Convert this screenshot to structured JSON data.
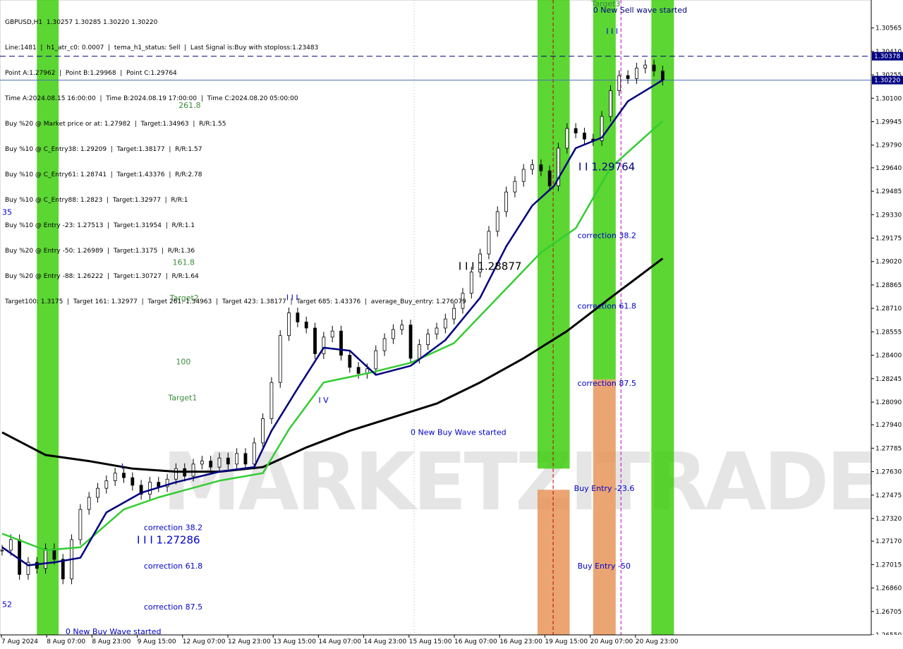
{
  "symbol_line": "GBPUSD,H1  1.30257 1.30285 1.30220 1.30220",
  "info_lines": [
    "Line:1481  |  h1_atr_c0: 0.0007  |  tema_h1_status: Sell  |  Last Signal is:Buy with stoploss:1.23483",
    "Point A:1.27962  |  Point B:1.29968  |  Point C:1.29764",
    "Time A:2024.08.15 16:00:00  |  Time B:2024.08.19 17:00:00  |  Time C:2024.08.20 05:00:00",
    "Buy %20 @ Market price or at: 1.27982  |  Target:1.34963  |  R/R:1.55",
    "Buy %10 @ C_Entry38: 1.29209  |  Target:1.38177  |  R/R:1.57",
    "Buy %10 @ C_Entry61: 1.28741  |  Target:1.43376  |  R/R:2.78",
    "Buy %10 @ C_Entry88: 1.2823  |  Target:1.32977  |  R/R:1",
    "Buy %10 @ Entry -23: 1.27513  |  Target:1.31954  |  R/R:1.1",
    "Buy %20 @ Entry -50: 1.26989  |  Target:1.3175  |  R/R:1.36",
    "Buy %20 @ Entry -88: 1.26222  |  Target:1.30727  |  R/R:1.64",
    "Target100: 1.3175  |  Target 161: 1.32977  |  Target 261: 1.34963  |  Target 423: 1.38177  |  Target 685: 1.43376  |  average_Buy_entry: 1.276079"
  ],
  "watermark": "MARKETZITRADE",
  "colors": {
    "green_band": "#33cc00",
    "orange_zone": "#e8955a",
    "blue_line": "#000080",
    "green_ma": "#32cd32",
    "black_ma": "#000000",
    "red_arrow": "#ff0000",
    "blue_arrow": "#0000ff",
    "current_price_line": "#000080",
    "price_tag_bg": "#000080"
  },
  "chart_data": {
    "type": "candlestick",
    "symbol": "GBPUSD",
    "timeframe": "H1",
    "ohlc_last": {
      "open": 1.30257,
      "high": 1.30285,
      "low": 1.3022,
      "close": 1.3022
    },
    "ylim": [
      1.2655,
      1.3075
    ],
    "y_ticks": [
      "1.30565",
      "1.30410",
      "1.30255",
      "1.30100",
      "1.29945",
      "1.29790",
      "1.29640",
      "1.29485",
      "1.29330",
      "1.29175",
      "1.29020",
      "1.28865",
      "1.28710",
      "1.28555",
      "1.28400",
      "1.28245",
      "1.28090",
      "1.27940",
      "1.27785",
      "1.27630",
      "1.27475",
      "1.27320",
      "1.27170",
      "1.27015",
      "1.26860",
      "1.26705",
      "1.26550"
    ],
    "x_ticks": [
      "7 Aug 2024",
      "8 Aug 07:00",
      "8 Aug 23:00",
      "9 Aug 15:00",
      "12 Aug 07:00",
      "12 Aug 23:00",
      "13 Aug 15:00",
      "14 Aug 07:00",
      "14 Aug 23:00",
      "15 Aug 15:00",
      "16 Aug 07:00",
      "16 Aug 23:00",
      "19 Aug 15:00",
      "20 Aug 07:00",
      "20 Aug 23:00"
    ],
    "price_tags": [
      {
        "label": "1.30378",
        "price": 1.30378
      },
      {
        "label": "1.30220",
        "price": 1.3022
      }
    ],
    "annotations": [
      {
        "text": "0 New Sell wave started",
        "t": 0.68,
        "price": 1.30665
      },
      {
        "text": "I I I",
        "t": 0.695,
        "price": 1.30525
      },
      {
        "text": "I I 1.29764",
        "t": 0.663,
        "price": 1.29623
      },
      {
        "text": "I I I 1.28877",
        "t": 0.525,
        "price": 1.28965
      },
      {
        "text": "I I I",
        "t": 0.327,
        "price": 1.28765
      },
      {
        "text": "I V",
        "t": 0.364,
        "price": 1.28085
      },
      {
        "text": "0 New Buy Wave started",
        "t": 0.47,
        "price": 1.27873
      },
      {
        "text": "I",
        "t": 0.137,
        "price": 1.27647
      },
      {
        "text": "I I I 1.27286",
        "t": 0.155,
        "price": 1.27154
      },
      {
        "text": "0 New Buy Wave started",
        "t": 0.073,
        "price": 1.26555
      },
      {
        "text": "52",
        "t": 0.0,
        "price": 1.26735
      },
      {
        "text": "35",
        "t": 0.0,
        "price": 1.2933
      },
      {
        "text": "161.8",
        "t": 0.196,
        "price": 1.28997
      },
      {
        "text": "Target2",
        "t": 0.193,
        "price": 1.28763
      },
      {
        "text": "100",
        "t": 0.2,
        "price": 1.28339
      },
      {
        "text": "Target1",
        "t": 0.191,
        "price": 1.28101
      },
      {
        "text": "261.8",
        "t": 0.203,
        "price": 1.30035
      },
      {
        "text": "Target3",
        "t": 0.678,
        "price": 1.30707
      },
      {
        "text": "correction 38.2",
        "t": 0.163,
        "price": 1.27244
      },
      {
        "text": "correction 61.8",
        "t": 0.163,
        "price": 1.26988
      },
      {
        "text": "correction 87.5",
        "t": 0.163,
        "price": 1.26718
      },
      {
        "text": "correction 38.2",
        "t": 0.662,
        "price": 1.29175
      },
      {
        "text": "correction 61.8",
        "t": 0.662,
        "price": 1.28709
      },
      {
        "text": "correction 87.5",
        "t": 0.662,
        "price": 1.28198
      },
      {
        "text": "Buy Entry -23.6",
        "t": 0.658,
        "price": 1.27503
      },
      {
        "text": "Buy Entry -50",
        "t": 0.662,
        "price": 1.26988
      }
    ],
    "green_bands": [
      {
        "t_start": 0.04,
        "t_end": 0.065,
        "from_price": 1.3075,
        "to_price": 1.2655
      },
      {
        "t_start": 0.616,
        "t_end": 0.653,
        "from_price": 1.3075,
        "to_price": 1.2765
      },
      {
        "t_start": 0.68,
        "t_end": 0.706,
        "from_price": 1.3075,
        "to_price": 1.2824
      },
      {
        "t_start": 0.747,
        "t_end": 0.773,
        "from_price": 1.3075,
        "to_price": 1.2655
      }
    ],
    "orange_zones": [
      {
        "t_start": 0.616,
        "t_end": 0.653,
        "from_price": 1.2751,
        "to_price": 1.2655
      },
      {
        "t_start": 0.68,
        "t_end": 0.706,
        "from_price": 1.2824,
        "to_price": 1.2655
      }
    ],
    "dashed_horizontal": [
      1.30378
    ],
    "solid_horizontal": [
      1.3022
    ],
    "vertical_markers": [
      {
        "t": 0.634,
        "style": "dashed",
        "color": "#c00000"
      },
      {
        "t": 0.712,
        "style": "dashed",
        "color": "#c000c0"
      },
      {
        "t": 0.474,
        "style": "dotted",
        "color": "#a0c0c0"
      }
    ],
    "black_ma": [
      [
        0.0,
        1.2789
      ],
      [
        0.05,
        1.2774
      ],
      [
        0.1,
        1.277
      ],
      [
        0.15,
        1.2765
      ],
      [
        0.2,
        1.2763
      ],
      [
        0.25,
        1.2763
      ],
      [
        0.3,
        1.2766
      ],
      [
        0.35,
        1.2779
      ],
      [
        0.4,
        1.279
      ],
      [
        0.45,
        1.2799
      ],
      [
        0.5,
        1.2808
      ],
      [
        0.55,
        1.2822
      ],
      [
        0.6,
        1.2838
      ],
      [
        0.65,
        1.2856
      ],
      [
        0.7,
        1.2878
      ],
      [
        0.76,
        1.2904
      ]
    ],
    "green_ma": [
      [
        0.0,
        1.2722
      ],
      [
        0.05,
        1.2711
      ],
      [
        0.09,
        1.2713
      ],
      [
        0.14,
        1.2738
      ],
      [
        0.18,
        1.2746
      ],
      [
        0.25,
        1.2757
      ],
      [
        0.3,
        1.2762
      ],
      [
        0.33,
        1.2791
      ],
      [
        0.37,
        1.2822
      ],
      [
        0.42,
        1.2828
      ],
      [
        0.47,
        1.2835
      ],
      [
        0.52,
        1.2848
      ],
      [
        0.57,
        1.2878
      ],
      [
        0.62,
        1.2908
      ],
      [
        0.66,
        1.2924
      ],
      [
        0.7,
        1.2964
      ],
      [
        0.76,
        1.2995
      ]
    ],
    "blue_line": [
      [
        0.0,
        1.2713
      ],
      [
        0.03,
        1.2701
      ],
      [
        0.06,
        1.2703
      ],
      [
        0.09,
        1.2706
      ],
      [
        0.12,
        1.2736
      ],
      [
        0.16,
        1.2749
      ],
      [
        0.2,
        1.2756
      ],
      [
        0.25,
        1.2763
      ],
      [
        0.29,
        1.2766
      ],
      [
        0.31,
        1.279
      ],
      [
        0.34,
        1.2818
      ],
      [
        0.37,
        1.2845
      ],
      [
        0.4,
        1.2843
      ],
      [
        0.43,
        1.2827
      ],
      [
        0.47,
        1.2833
      ],
      [
        0.51,
        1.285
      ],
      [
        0.55,
        1.2878
      ],
      [
        0.58,
        1.2912
      ],
      [
        0.61,
        1.2939
      ],
      [
        0.635,
        1.2952
      ],
      [
        0.66,
        1.2977
      ],
      [
        0.69,
        1.2984
      ],
      [
        0.72,
        1.3008
      ],
      [
        0.76,
        1.3022
      ]
    ],
    "candles": [
      [
        0.0,
        1.2711
      ],
      [
        0.01,
        1.2718
      ],
      [
        0.02,
        1.2695
      ],
      [
        0.03,
        1.2703
      ],
      [
        0.04,
        1.2699
      ],
      [
        0.05,
        1.2712
      ],
      [
        0.06,
        1.2705
      ],
      [
        0.07,
        1.2692
      ],
      [
        0.08,
        1.2718
      ],
      [
        0.09,
        1.2738
      ],
      [
        0.1,
        1.2746
      ],
      [
        0.11,
        1.2752
      ],
      [
        0.12,
        1.2757
      ],
      [
        0.13,
        1.2762
      ],
      [
        0.14,
        1.2759
      ],
      [
        0.15,
        1.2754
      ],
      [
        0.16,
        1.2748
      ],
      [
        0.17,
        1.2756
      ],
      [
        0.18,
        1.2753
      ],
      [
        0.19,
        1.2758
      ],
      [
        0.2,
        1.2765
      ],
      [
        0.21,
        1.276
      ],
      [
        0.22,
        1.2768
      ],
      [
        0.23,
        1.277
      ],
      [
        0.24,
        1.2766
      ],
      [
        0.25,
        1.2772
      ],
      [
        0.26,
        1.2768
      ],
      [
        0.27,
        1.2775
      ],
      [
        0.28,
        1.2768
      ],
      [
        0.29,
        1.2782
      ],
      [
        0.3,
        1.2798
      ],
      [
        0.31,
        1.2822
      ],
      [
        0.32,
        1.2853
      ],
      [
        0.33,
        1.2868
      ],
      [
        0.34,
        1.2862
      ],
      [
        0.35,
        1.2858
      ],
      [
        0.36,
        1.2841
      ],
      [
        0.37,
        1.2852
      ],
      [
        0.38,
        1.2856
      ],
      [
        0.39,
        1.284
      ],
      [
        0.4,
        1.2832
      ],
      [
        0.41,
        1.2828
      ],
      [
        0.42,
        1.2831
      ],
      [
        0.43,
        1.2843
      ],
      [
        0.44,
        1.2851
      ],
      [
        0.45,
        1.2857
      ],
      [
        0.46,
        1.286
      ],
      [
        0.47,
        1.2838
      ],
      [
        0.48,
        1.2847
      ],
      [
        0.49,
        1.2854
      ],
      [
        0.5,
        1.2858
      ],
      [
        0.51,
        1.2864
      ],
      [
        0.52,
        1.2871
      ],
      [
        0.53,
        1.2881
      ],
      [
        0.54,
        1.2895
      ],
      [
        0.55,
        1.2907
      ],
      [
        0.56,
        1.2922
      ],
      [
        0.57,
        1.2935
      ],
      [
        0.58,
        1.2948
      ],
      [
        0.59,
        1.2955
      ],
      [
        0.6,
        1.2963
      ],
      [
        0.61,
        1.2966
      ],
      [
        0.62,
        1.2962
      ],
      [
        0.63,
        1.2952
      ],
      [
        0.64,
        1.2977
      ],
      [
        0.65,
        1.299
      ],
      [
        0.66,
        1.2987
      ],
      [
        0.67,
        1.2983
      ],
      [
        0.68,
        1.2982
      ],
      [
        0.69,
        1.2998
      ],
      [
        0.7,
        1.3015
      ],
      [
        0.71,
        1.3025
      ],
      [
        0.72,
        1.3023
      ],
      [
        0.73,
        1.303
      ],
      [
        0.74,
        1.3032
      ],
      [
        0.75,
        1.3028
      ],
      [
        0.76,
        1.3022
      ]
    ]
  }
}
